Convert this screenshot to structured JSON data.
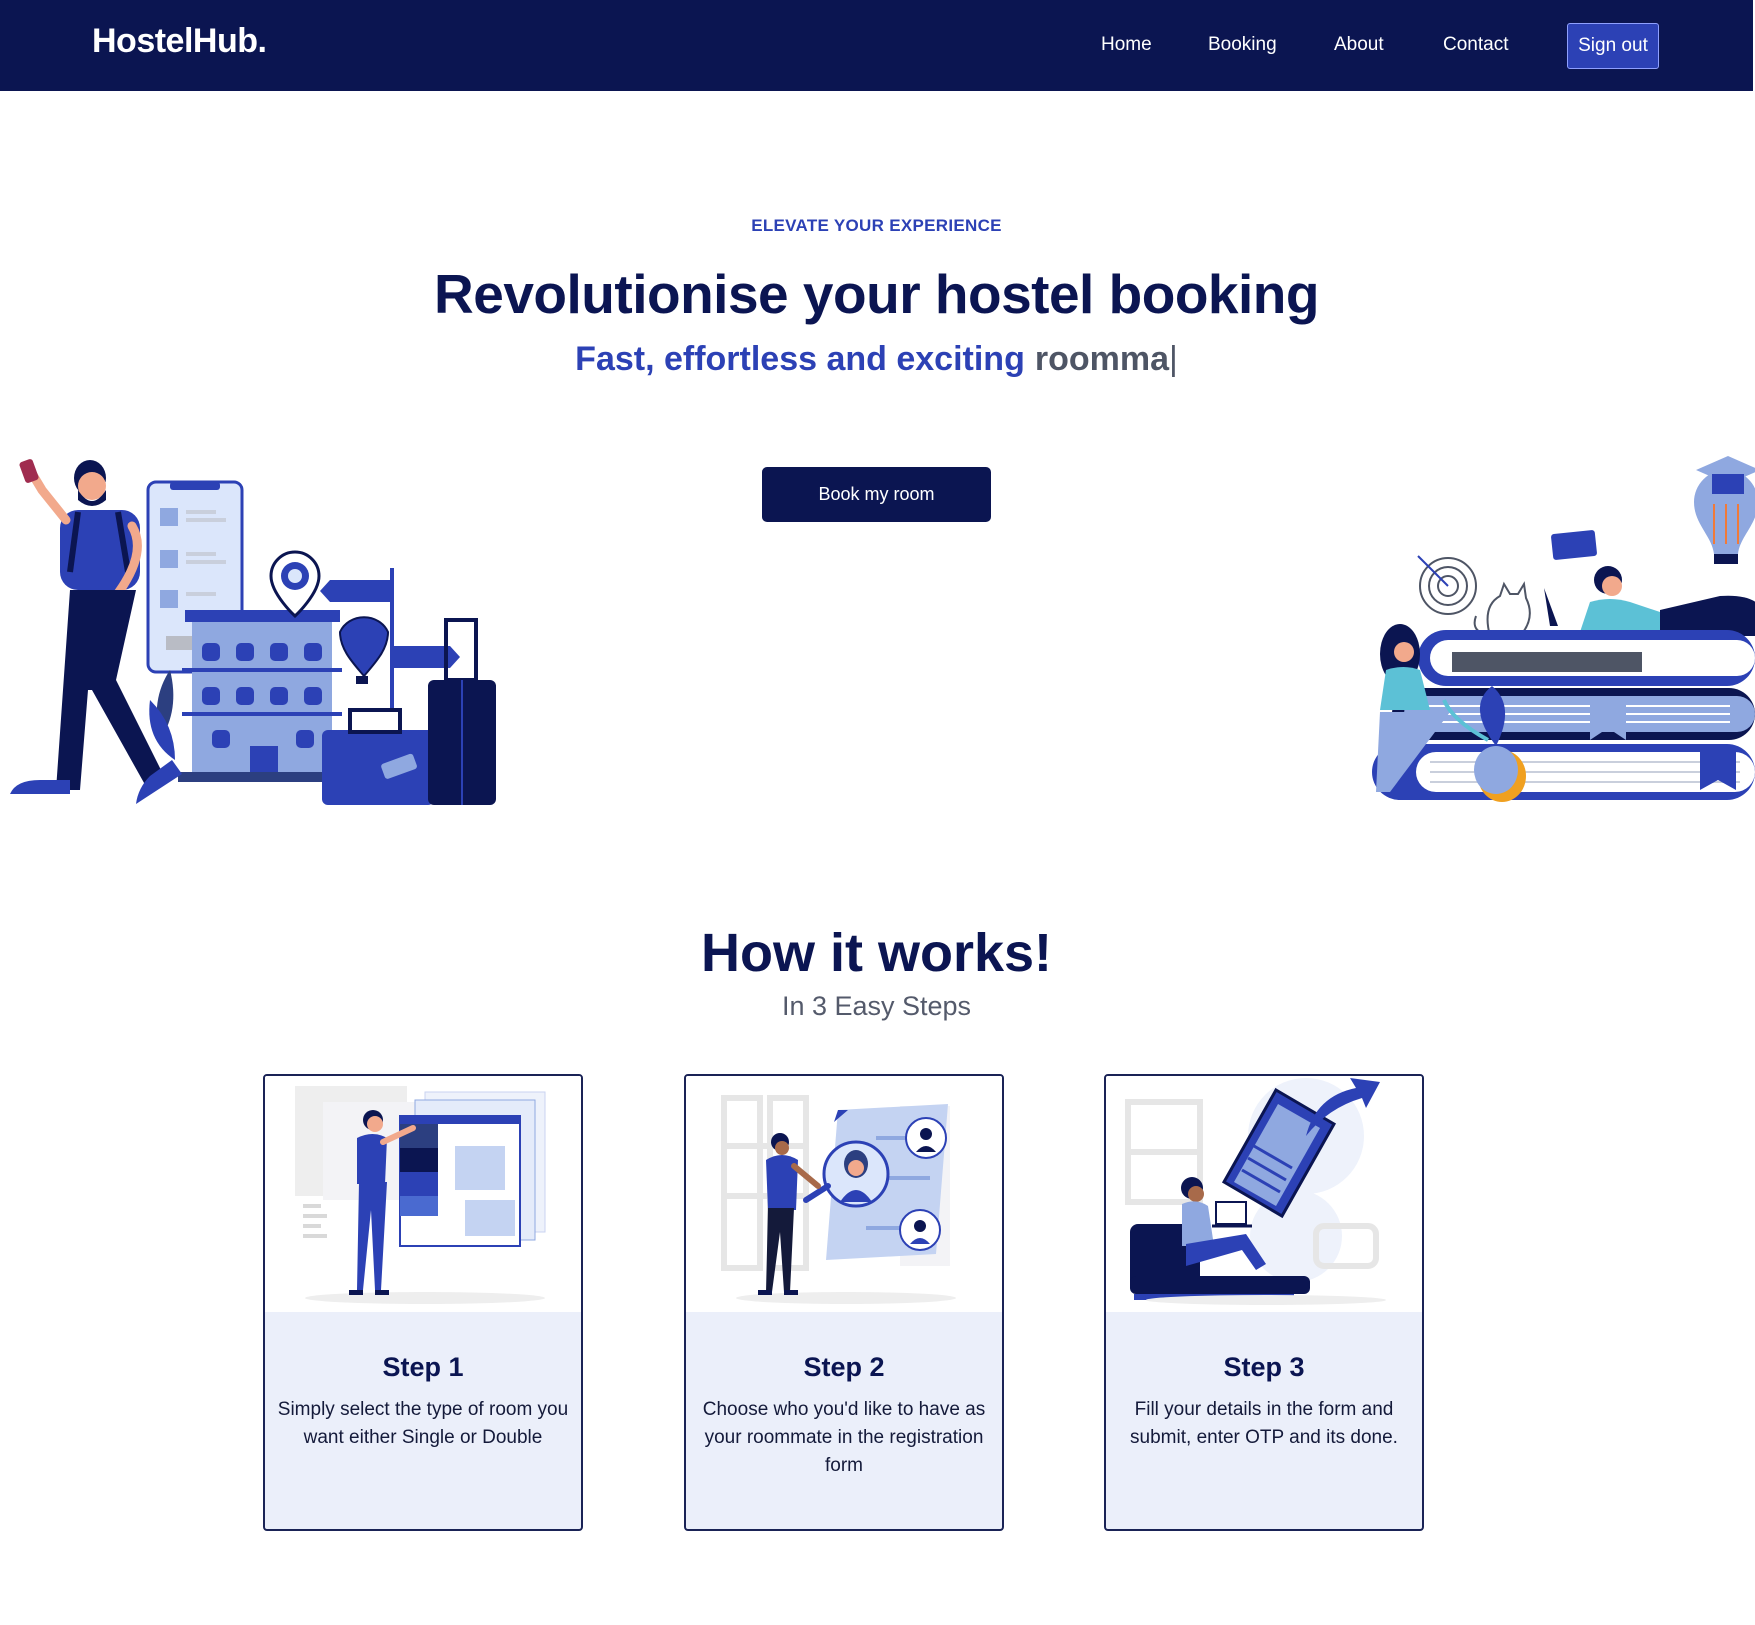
{
  "navbar": {
    "logo": "HostelHub.",
    "links": [
      "Home",
      "Booking",
      "About",
      "Contact"
    ],
    "signout_label": "Sign out"
  },
  "hero": {
    "eyebrow": "ELEVATE YOUR EXPERIENCE",
    "title": "Revolutionise your hostel booking",
    "subtitle_lead": "Fast, effortless and exciting",
    "subtitle_typed": "roomma",
    "cursor": "|",
    "cta_label": "Book my room"
  },
  "how": {
    "title": "How it works!",
    "subtitle": "In 3 Easy Steps",
    "steps": [
      {
        "title": "Step 1",
        "text": "Simply select the type of room you want either Single or Double"
      },
      {
        "title": "Step 2",
        "text": "Choose who you'd like to have as your roommate in the registration form"
      },
      {
        "title": "Step 3",
        "text": "Fill your details in the form and submit, enter OTP and its done."
      }
    ]
  },
  "colors": {
    "navy": "#0b1551",
    "accent": "#2c41b5",
    "card_bg": "#ebeffa"
  }
}
